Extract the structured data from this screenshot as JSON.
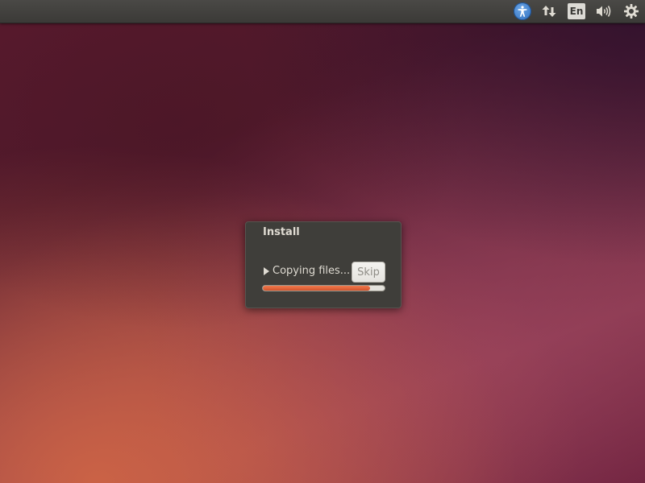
{
  "top_panel": {
    "indicators": [
      {
        "name": "accessibility-icon"
      },
      {
        "name": "network-icon"
      },
      {
        "name": "keyboard-layout",
        "label": "En"
      },
      {
        "name": "sound-icon"
      },
      {
        "name": "power-icon"
      }
    ]
  },
  "dialog": {
    "title": "Install",
    "status": "Copying files...",
    "skip_label": "Skip",
    "progress": 0.88
  },
  "colors": {
    "accent": "#e0622f",
    "panel": "#3b3a37",
    "dialog_bg": "#3f3e3a"
  }
}
